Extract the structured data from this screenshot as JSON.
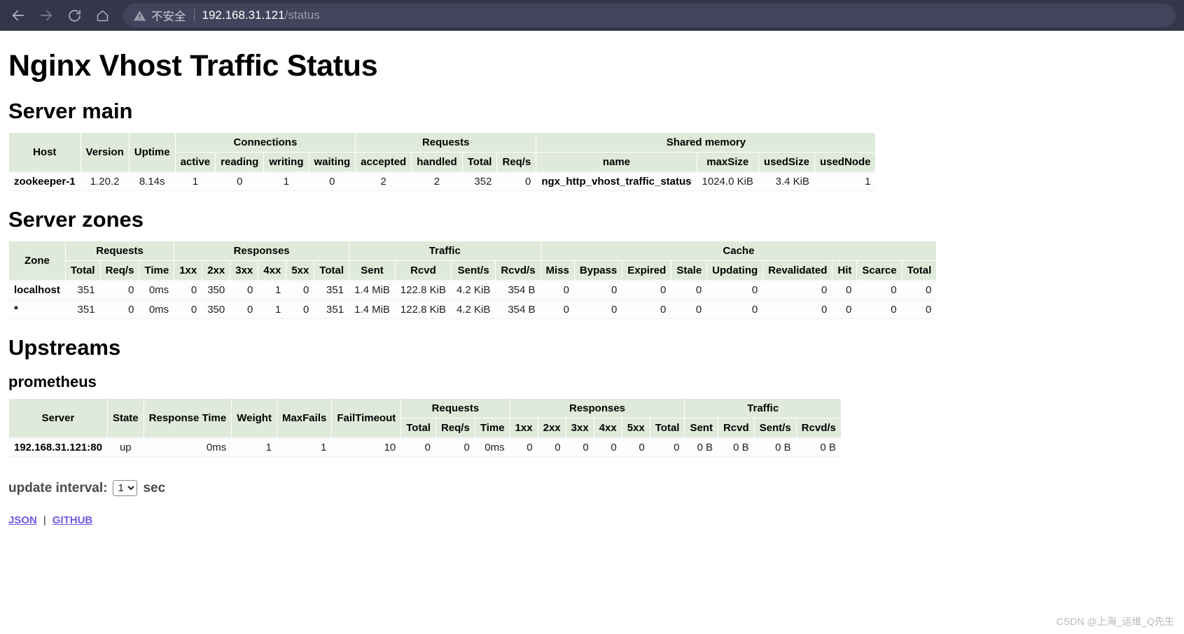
{
  "browser": {
    "back_icon": "arrow-left-icon",
    "forward_icon": "arrow-right-icon",
    "reload_icon": "reload-icon",
    "home_icon": "home-icon",
    "security_icon": "warning-triangle-icon",
    "security_label": "不安全",
    "url_host": "192.168.31.121",
    "url_path": "/status"
  },
  "page": {
    "title": "Nginx Vhost Traffic Status"
  },
  "server_main": {
    "heading": "Server main",
    "group_headers": {
      "host": "Host",
      "version": "Version",
      "uptime": "Uptime",
      "connections": "Connections",
      "requests": "Requests",
      "shared_memory": "Shared memory"
    },
    "sub_headers": {
      "active": "active",
      "reading": "reading",
      "writing": "writing",
      "waiting": "waiting",
      "accepted": "accepted",
      "handled": "handled",
      "total": "Total",
      "reqs": "Req/s",
      "name": "name",
      "max_size": "maxSize",
      "used_size": "usedSize",
      "used_node": "usedNode"
    },
    "row": {
      "host": "zookeeper-1",
      "version": "1.20.2",
      "uptime": "8.14s",
      "active": "1",
      "reading": "0",
      "writing": "1",
      "waiting": "0",
      "accepted": "2",
      "handled": "2",
      "total": "352",
      "reqs": "0",
      "name": "ngx_http_vhost_traffic_status",
      "max_size": "1024.0 KiB",
      "used_size": "3.4 KiB",
      "used_node": "1"
    }
  },
  "server_zones": {
    "heading": "Server zones",
    "group_headers": {
      "zone": "Zone",
      "requests": "Requests",
      "responses": "Responses",
      "traffic": "Traffic",
      "cache": "Cache"
    },
    "sub_headers": {
      "req_total": "Total",
      "req_reqs": "Req/s",
      "req_time": "Time",
      "r1xx": "1xx",
      "r2xx": "2xx",
      "r3xx": "3xx",
      "r4xx": "4xx",
      "r5xx": "5xx",
      "resp_total": "Total",
      "sent": "Sent",
      "rcvd": "Rcvd",
      "sent_s": "Sent/s",
      "rcvd_s": "Rcvd/s",
      "miss": "Miss",
      "bypass": "Bypass",
      "expired": "Expired",
      "stale": "Stale",
      "updating": "Updating",
      "revalidated": "Revalidated",
      "hit": "Hit",
      "scarce": "Scarce",
      "cache_total": "Total"
    },
    "rows": [
      {
        "zone": "localhost",
        "req_total": "351",
        "req_reqs": "0",
        "req_time": "0ms",
        "r1xx": "0",
        "r2xx": "350",
        "r3xx": "0",
        "r4xx": "1",
        "r5xx": "0",
        "resp_total": "351",
        "sent": "1.4 MiB",
        "rcvd": "122.8 KiB",
        "sent_s": "4.2 KiB",
        "rcvd_s": "354 B",
        "miss": "0",
        "bypass": "0",
        "expired": "0",
        "stale": "0",
        "updating": "0",
        "revalidated": "0",
        "hit": "0",
        "scarce": "0",
        "cache_total": "0"
      },
      {
        "zone": "*",
        "req_total": "351",
        "req_reqs": "0",
        "req_time": "0ms",
        "r1xx": "0",
        "r2xx": "350",
        "r3xx": "0",
        "r4xx": "1",
        "r5xx": "0",
        "resp_total": "351",
        "sent": "1.4 MiB",
        "rcvd": "122.8 KiB",
        "sent_s": "4.2 KiB",
        "rcvd_s": "354 B",
        "miss": "0",
        "bypass": "0",
        "expired": "0",
        "stale": "0",
        "updating": "0",
        "revalidated": "0",
        "hit": "0",
        "scarce": "0",
        "cache_total": "0"
      }
    ]
  },
  "upstreams": {
    "heading": "Upstreams",
    "group_name": "prometheus",
    "group_headers": {
      "server": "Server",
      "state": "State",
      "response_time": "Response Time",
      "weight": "Weight",
      "max_fails": "MaxFails",
      "fail_timeout": "FailTimeout",
      "requests": "Requests",
      "responses": "Responses",
      "traffic": "Traffic"
    },
    "sub_headers": {
      "req_total": "Total",
      "req_reqs": "Req/s",
      "req_time": "Time",
      "r1xx": "1xx",
      "r2xx": "2xx",
      "r3xx": "3xx",
      "r4xx": "4xx",
      "r5xx": "5xx",
      "resp_total": "Total",
      "sent": "Sent",
      "rcvd": "Rcvd",
      "sent_s": "Sent/s",
      "rcvd_s": "Rcvd/s"
    },
    "rows": [
      {
        "server": "192.168.31.121:80",
        "state": "up",
        "response_time": "0ms",
        "weight": "1",
        "max_fails": "1",
        "fail_timeout": "10",
        "req_total": "0",
        "req_reqs": "0",
        "req_time": "0ms",
        "r1xx": "0",
        "r2xx": "0",
        "r3xx": "0",
        "r4xx": "0",
        "r5xx": "0",
        "resp_total": "0",
        "sent": "0 B",
        "rcvd": "0 B",
        "sent_s": "0 B",
        "rcvd_s": "0 B"
      }
    ]
  },
  "footer": {
    "interval_label": "update interval:",
    "interval_value": "1",
    "interval_options": [
      "1"
    ],
    "interval_unit": "sec",
    "json_link": "JSON",
    "separator": "|",
    "github_link": "GITHUB"
  },
  "watermark": "CSDN @上海_运维_Q先生"
}
